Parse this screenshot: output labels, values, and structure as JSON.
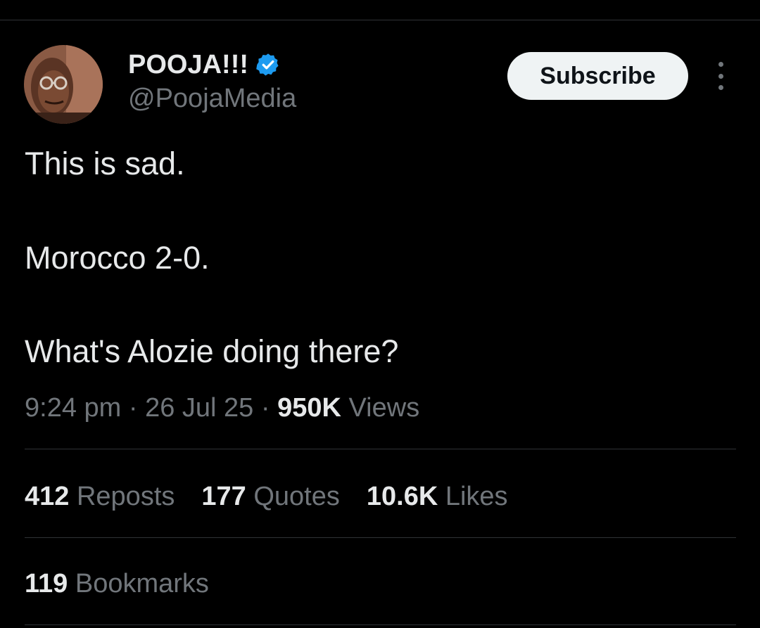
{
  "author": {
    "display_name": "POOJA!!!",
    "handle": "@PoojaMedia",
    "verified_icon": "verified-badge-icon",
    "verified_color": "#1d9bf0"
  },
  "actions": {
    "subscribe_label": "Subscribe",
    "more_icon": "more-options-icon"
  },
  "tweet": {
    "lines": [
      "This is sad.",
      "Morocco 2-0.",
      "What's Alozie doing there?"
    ]
  },
  "meta": {
    "time": "9:24 pm",
    "separator": "·",
    "date": "26 Jul 25",
    "views_count": "950K",
    "views_label": "Views"
  },
  "stats": {
    "reposts_count": "412",
    "reposts_label": "Reposts",
    "quotes_count": "177",
    "quotes_label": "Quotes",
    "likes_count": "10.6K",
    "likes_label": "Likes",
    "bookmarks_count": "119",
    "bookmarks_label": "Bookmarks"
  },
  "colors": {
    "background": "#000000",
    "text_primary": "#e7e9ea",
    "text_secondary": "#71767b",
    "divider": "#2f3336",
    "button_bg": "#eff3f4",
    "button_text": "#0f1419"
  }
}
